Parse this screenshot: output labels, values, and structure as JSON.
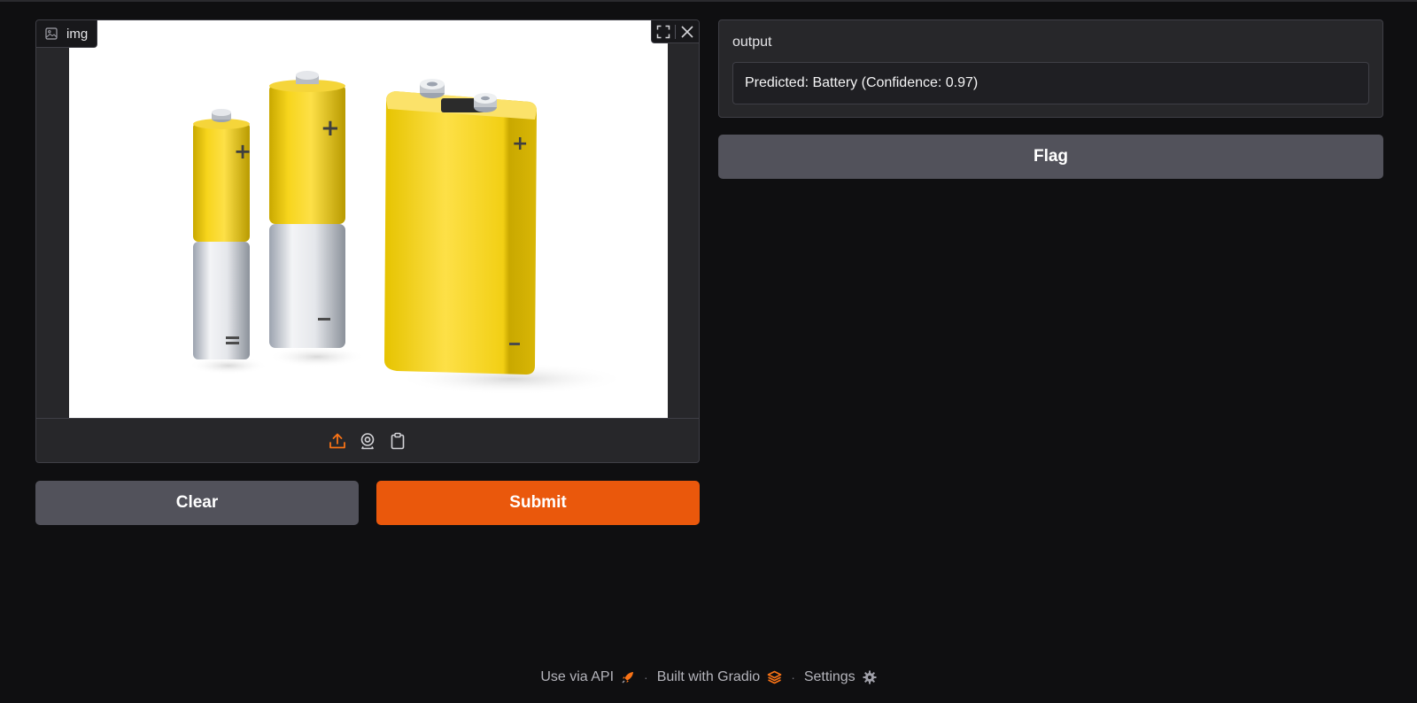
{
  "input": {
    "label": "img",
    "image_alt": "Three yellow and silver batteries",
    "tools": [
      "fullscreen-icon",
      "close-icon"
    ],
    "sources": [
      "upload-icon",
      "webcam-icon",
      "clipboard-icon"
    ]
  },
  "buttons": {
    "clear": "Clear",
    "submit": "Submit",
    "flag": "Flag"
  },
  "output": {
    "label": "output",
    "text": "Predicted: Battery (Confidence: 0.97)"
  },
  "footer": {
    "api": "Use via API",
    "built": "Built with Gradio",
    "settings": "Settings",
    "separator": "·"
  },
  "colors": {
    "background": "#0f0f11",
    "panel": "#27272a",
    "primary": "#ea580c",
    "secondary": "#52525b",
    "accent_icon": "#f97316"
  }
}
